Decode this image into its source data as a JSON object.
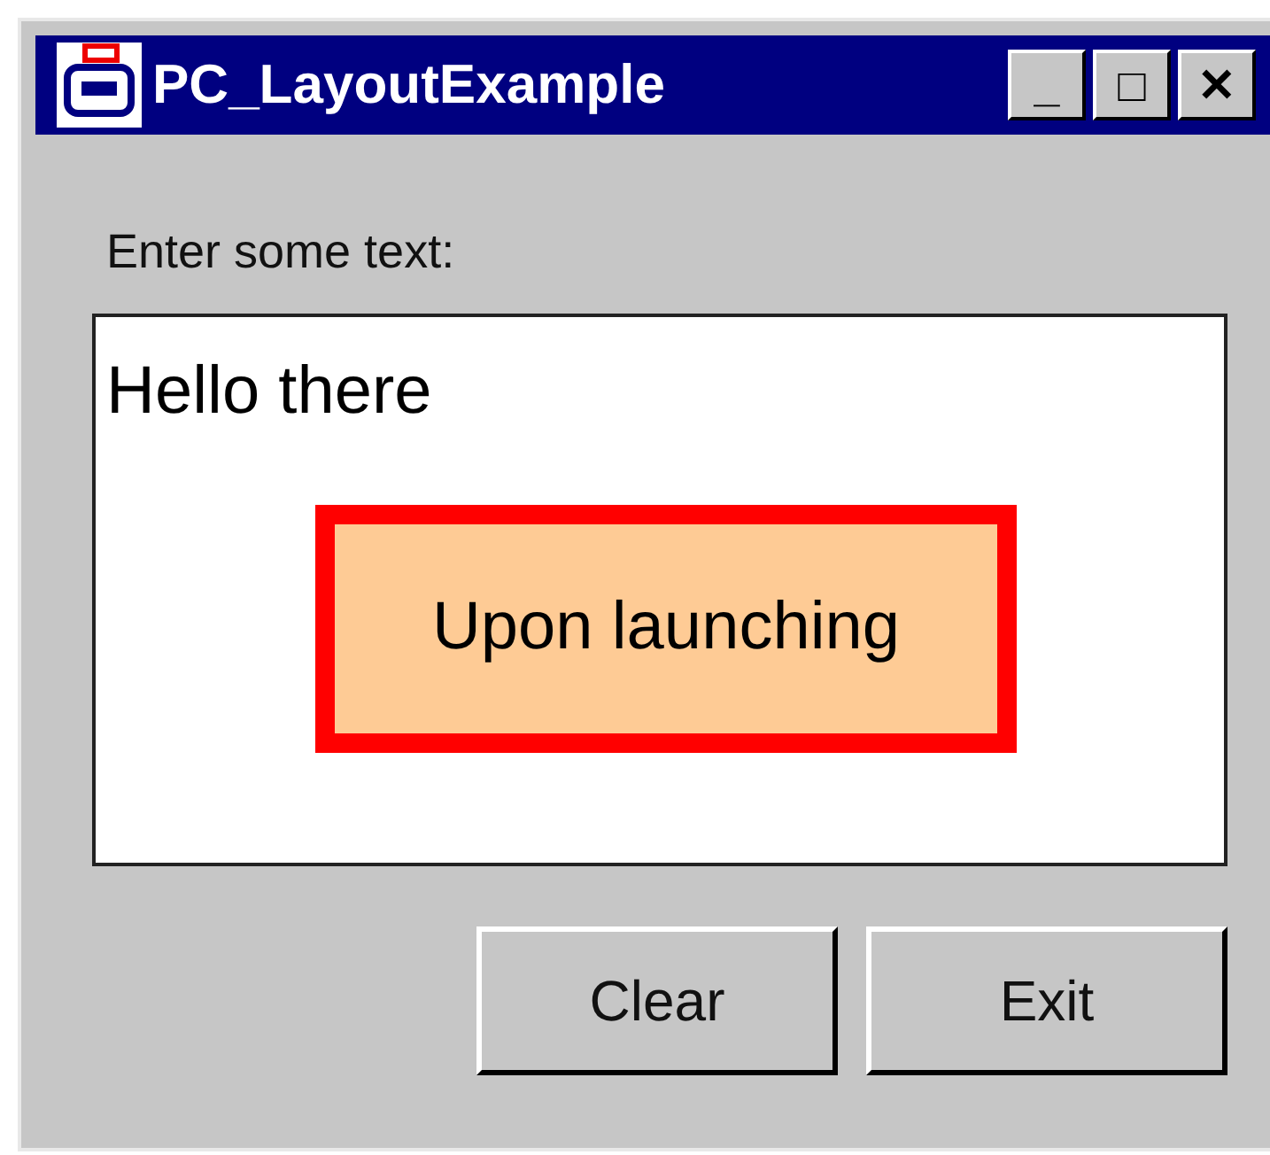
{
  "window": {
    "title": "PC_LayoutExample",
    "controls": [
      "_",
      "□",
      "✕"
    ]
  },
  "prompt": "Enter some text:",
  "text_area": {
    "value": "Hello there"
  },
  "callout": {
    "text": "Upon launching"
  },
  "buttons": [
    "Clear",
    "Exit"
  ]
}
